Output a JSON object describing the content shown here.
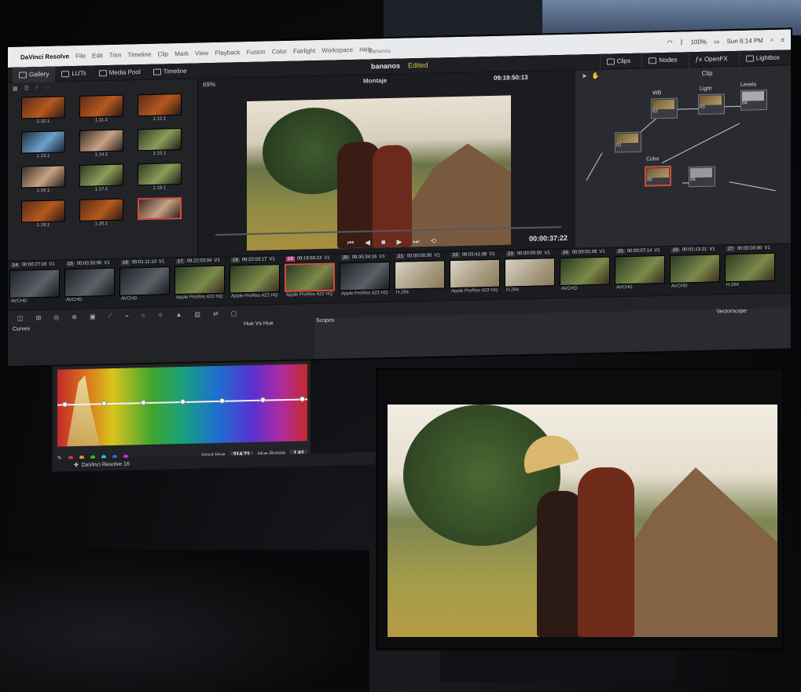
{
  "menubar": {
    "app": "DaVinci Resolve",
    "items": [
      "File",
      "Edit",
      "Trim",
      "Timeline",
      "Clip",
      "Mark",
      "View",
      "Playback",
      "Fusion",
      "Color",
      "Fairlight",
      "Workspace",
      "Help"
    ],
    "window_title": "bananos",
    "battery": "100%",
    "clock": "Sun 6:14 PM"
  },
  "topbar": {
    "gallery": "Gallery",
    "luts": "LUTs",
    "media_pool": "Media Pool",
    "timeline": "Timeline",
    "project": "bananos",
    "status": "Edited",
    "clips": "Clips",
    "nodes": "Nodes",
    "openfx": "OpenFX",
    "lightbox": "Lightbox"
  },
  "viewer": {
    "zoom": "69%",
    "timeline_name": "Montaje",
    "timecode": "09:19:50:13",
    "duration": "00:00:37:22"
  },
  "gallery": {
    "stills": [
      "1.10.1",
      "1.11.1",
      "1.12.1",
      "1.13.1",
      "1.14.1",
      "1.15.1",
      "1.16.1",
      "1.17.1",
      "1.18.1",
      "1.19.1",
      "1.20.1",
      "",
      ""
    ]
  },
  "nodes": {
    "mode": "Clip",
    "labels": {
      "wb": "WB",
      "light": "Light",
      "levels": "Levels",
      "color": "Color"
    },
    "ids": [
      "01",
      "02",
      "03",
      "04",
      "05",
      "06"
    ]
  },
  "clips": [
    {
      "num": "14",
      "tc": "00:00:27:16",
      "track": "V1",
      "codec": "AVCHD"
    },
    {
      "num": "15",
      "tc": "00:00:30:06",
      "track": "V1",
      "codec": "AVCHD"
    },
    {
      "num": "16",
      "tc": "00:01:11:10",
      "track": "V1",
      "codec": "AVCHD"
    },
    {
      "num": "17",
      "tc": "09:22:03:04",
      "track": "V1",
      "codec": "Apple ProRes 422 HQ"
    },
    {
      "num": "18",
      "tc": "09:22:03:17",
      "track": "V1",
      "codec": "Apple ProRes 422 HQ"
    },
    {
      "num": "19",
      "tc": "09:19:50:13",
      "track": "V1",
      "codec": "Apple ProRes 422 HQ"
    },
    {
      "num": "20",
      "tc": "09:35:34:16",
      "track": "V1",
      "codec": "Apple ProRes 422 HQ"
    },
    {
      "num": "21",
      "tc": "00:00:00:00",
      "track": "V1",
      "codec": "H.264"
    },
    {
      "num": "22",
      "tc": "09:55:41:08",
      "track": "V1",
      "codec": "Apple ProRes 422 HQ"
    },
    {
      "num": "23",
      "tc": "00:00:00:00",
      "track": "V1",
      "codec": "H.264"
    },
    {
      "num": "24",
      "tc": "00:00:01:09",
      "track": "V1",
      "codec": "AVCHD"
    },
    {
      "num": "25",
      "tc": "00:00:07:14",
      "track": "V1",
      "codec": "AVCHD"
    },
    {
      "num": "26",
      "tc": "00:01:13:21",
      "track": "V1",
      "codec": "AVCHD"
    },
    {
      "num": "27",
      "tc": "00:00:00:00",
      "track": "V1",
      "codec": "H.264"
    }
  ],
  "curves": {
    "title": "Curves",
    "mode": "Hue Vs Hue",
    "scopes": "Scopes",
    "scope_type": "Vectorscope",
    "input_hue_label": "Input Hue",
    "input_hue": "314.71",
    "hue_rotate_label": "Hue Rotate",
    "hue_rotate": "1.61"
  },
  "footer": {
    "brand": "DaVinci Resolve 16"
  },
  "colors": {
    "accent_selected": "#d34a3f",
    "edited": "#d8c442",
    "current_clip": "#cc3b85"
  }
}
